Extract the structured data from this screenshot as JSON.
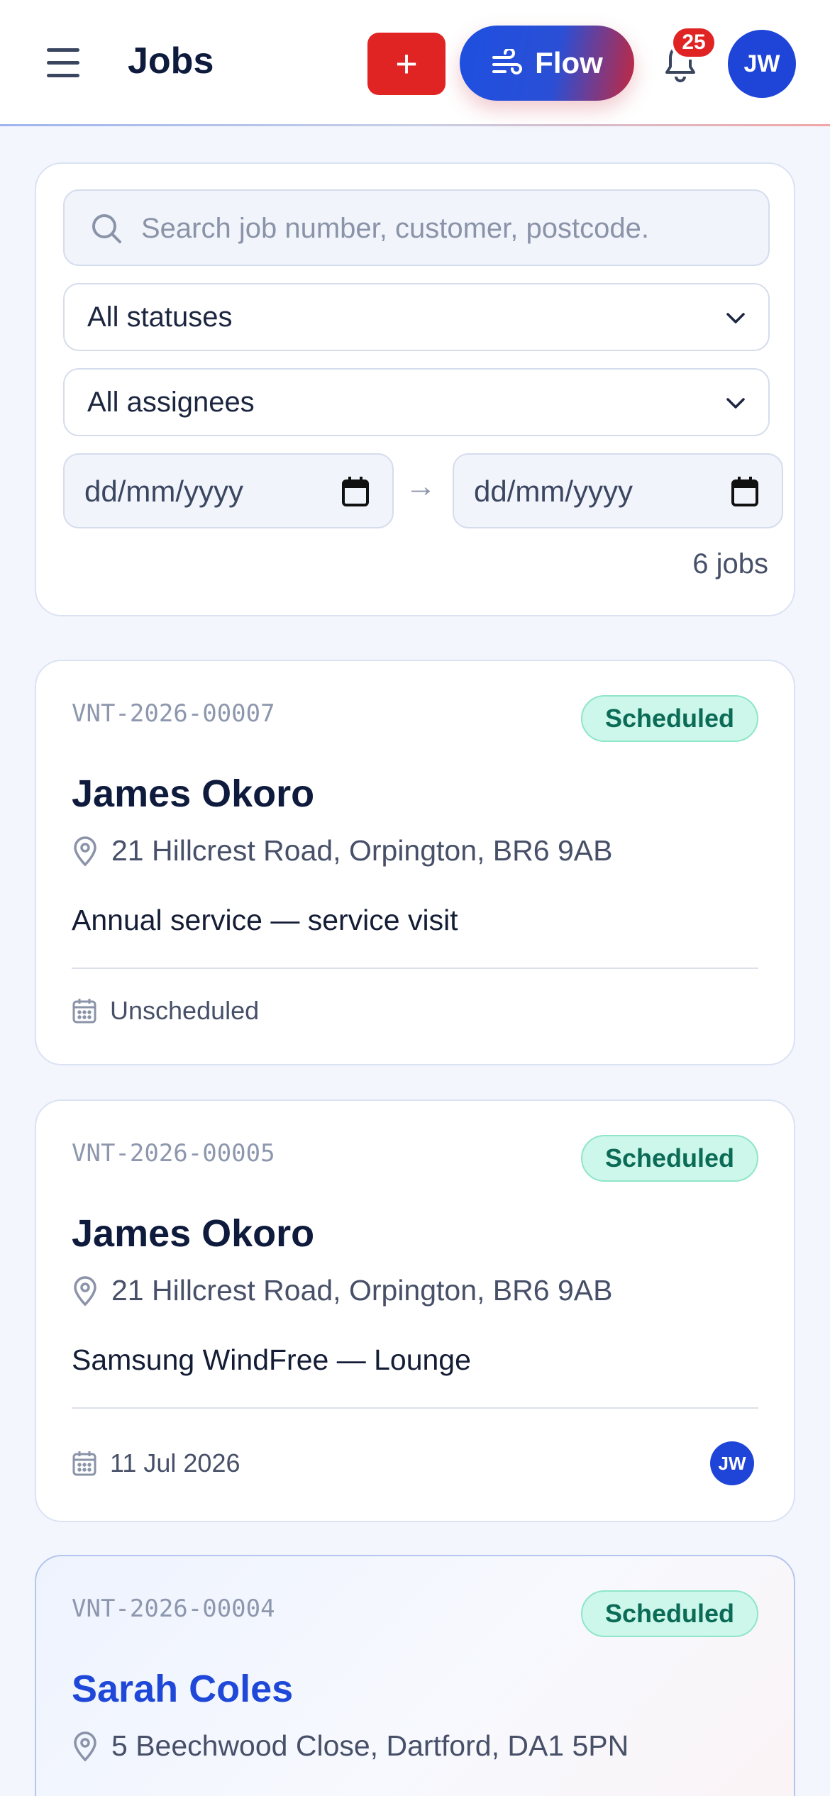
{
  "header": {
    "title": "Jobs",
    "add_label": "+",
    "flow_label": "Flow",
    "notification_count": "25",
    "user_initials": "JW"
  },
  "filters": {
    "search_placeholder": "Search job number, customer, postcode.",
    "status_select": "All statuses",
    "assignee_select": "All assignees",
    "date_from_placeholder": "dd/mm/yyyy",
    "date_to_placeholder": "dd/mm/yyyy",
    "date_separator": "→",
    "result_count": "6 jobs"
  },
  "jobs": [
    {
      "job_number": "VNT-2026-00007",
      "status": "Scheduled",
      "customer": "James Okoro",
      "address": "21 Hillcrest Road, Orpington, BR6 9AB",
      "description": "Annual service — service visit",
      "scheduled": "Unscheduled",
      "assignee": ""
    },
    {
      "job_number": "VNT-2026-00005",
      "status": "Scheduled",
      "customer": "James Okoro",
      "address": "21 Hillcrest Road, Orpington, BR6 9AB",
      "description": "Samsung WindFree — Lounge",
      "scheduled": "11 Jul 2026",
      "assignee": "JW"
    },
    {
      "job_number": "VNT-2026-00004",
      "status": "Scheduled",
      "customer": "Sarah Coles",
      "address": "5 Beechwood Close, Dartford, DA1 5PN"
    }
  ],
  "colors": {
    "brand_blue": "#1f45d8",
    "brand_red": "#e02424",
    "status_green": "#0b6b57"
  }
}
